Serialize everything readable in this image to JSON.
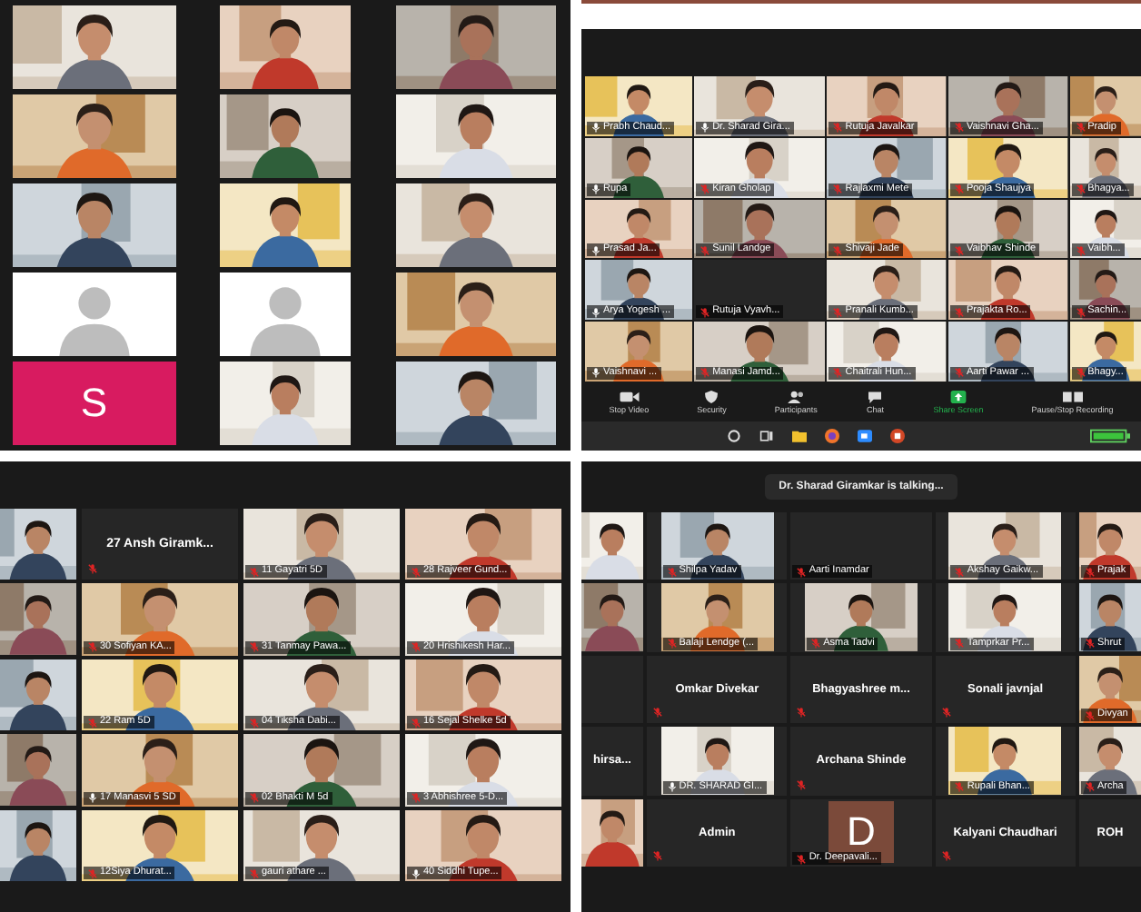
{
  "panels": [
    {
      "kind": "plain",
      "tiles": [
        {
          "kind": "video"
        },
        {
          "kind": "video"
        },
        {
          "kind": "video"
        },
        {
          "kind": "video"
        },
        {
          "kind": "video"
        },
        {
          "kind": "video"
        },
        {
          "kind": "video"
        },
        {
          "kind": "video"
        },
        {
          "kind": "video"
        },
        {
          "kind": "avatar"
        },
        {
          "kind": "avatar"
        },
        {
          "kind": "video"
        },
        {
          "kind": "letter",
          "letter": "S"
        },
        {
          "kind": "video"
        },
        {
          "kind": "video"
        }
      ]
    },
    {
      "kind": "zoom_window",
      "tiles": [
        {
          "kind": "video",
          "name": "Prabh Chaud...",
          "muted": false
        },
        {
          "kind": "video",
          "name": "Dr. Sharad Gira...",
          "muted": false
        },
        {
          "kind": "video",
          "name": "Rutuja Javalkar",
          "muted": true
        },
        {
          "kind": "video",
          "name": "Vaishnavi Gha...",
          "muted": true
        },
        {
          "kind": "video",
          "name": "Pradip",
          "muted": true
        },
        {
          "kind": "video",
          "name": "Rupa",
          "muted": false
        },
        {
          "kind": "video",
          "name": "Kiran Gholap",
          "muted": true
        },
        {
          "kind": "video",
          "name": "Rajlaxmi Mete",
          "muted": true
        },
        {
          "kind": "video",
          "name": "Pooja Shaujya",
          "muted": true
        },
        {
          "kind": "video",
          "name": "Bhagya...",
          "muted": true
        },
        {
          "kind": "video",
          "name": "Prasad Ja...",
          "muted": false
        },
        {
          "kind": "video",
          "name": "Sunil Landge",
          "muted": true
        },
        {
          "kind": "video",
          "name": "Shivaji Jade",
          "muted": true
        },
        {
          "kind": "video",
          "name": "Vaibhav Shinde",
          "muted": true
        },
        {
          "kind": "video",
          "name": "Vaibh...",
          "muted": true
        },
        {
          "kind": "video",
          "name": "Arya Yogesh ...",
          "muted": false
        },
        {
          "kind": "blank",
          "name": "Rutuja Vyavh...",
          "muted": true
        },
        {
          "kind": "video",
          "name": "Pranali Kumb...",
          "muted": true
        },
        {
          "kind": "video",
          "name": "Prajakta Ro...",
          "muted": true
        },
        {
          "kind": "video",
          "name": "Sachin...",
          "muted": true
        },
        {
          "kind": "video",
          "name": "Vaishnavi ...",
          "muted": false
        },
        {
          "kind": "video",
          "name": "Manasi Jamd...",
          "muted": true
        },
        {
          "kind": "video",
          "name": "Chaitrali Hun...",
          "muted": true
        },
        {
          "kind": "video",
          "name": "Aarti Pawar ...",
          "muted": true
        },
        {
          "kind": "video",
          "name": "Bhagy...",
          "muted": true
        }
      ],
      "toolbar": [
        {
          "label": "Stop Video"
        },
        {
          "label": "Security"
        },
        {
          "label": "Participants"
        },
        {
          "label": "Chat"
        },
        {
          "label": "Share Screen"
        },
        {
          "label": "Pause/Stop Recording"
        }
      ]
    },
    {
      "kind": "gallery",
      "tiles": [
        {
          "kind": "video"
        },
        {
          "kind": "name",
          "name": "27 Ansh Giramk...",
          "muted": true
        },
        {
          "kind": "video",
          "name": "11 Gayatri 5D",
          "muted": true
        },
        {
          "kind": "video",
          "name": "28 Rajveer Gund...",
          "muted": true
        },
        {
          "kind": "video"
        },
        {
          "kind": "video",
          "name": "30 Sofiyan KA...",
          "muted": true
        },
        {
          "kind": "video",
          "name": "31 Tanmay Pawa...",
          "muted": true
        },
        {
          "kind": "video",
          "name": "20 Hrishikesh Har...",
          "muted": true
        },
        {
          "kind": "video"
        },
        {
          "kind": "video",
          "name": "22 Ram 5D",
          "muted": true
        },
        {
          "kind": "video",
          "name": "04 Tiksha Dabi...",
          "muted": true
        },
        {
          "kind": "video",
          "name": "16 Sejal Shelke 5d",
          "muted": true
        },
        {
          "kind": "video"
        },
        {
          "kind": "video",
          "name": "17 Manasvi 5 SD",
          "muted": false
        },
        {
          "kind": "video",
          "name": "02 Bhakti M 5d",
          "muted": true
        },
        {
          "kind": "video",
          "name": "3 Abhishree 5-D...",
          "muted": true
        },
        {
          "kind": "video"
        },
        {
          "kind": "video",
          "name": "12Siya Dhurat...",
          "muted": true
        },
        {
          "kind": "video",
          "name": "gauri athare ...",
          "muted": true
        },
        {
          "kind": "video",
          "name": "40 Siddhi Tupe...",
          "muted": false
        }
      ]
    },
    {
      "kind": "talking",
      "banner": "Dr. Sharad Giramkar is talking...",
      "tiles": [
        {
          "kind": "video"
        },
        {
          "kind": "video",
          "name": "Shilpa Yadav",
          "muted": true
        },
        {
          "kind": "blank",
          "name": "Aarti Inamdar",
          "muted": true
        },
        {
          "kind": "video",
          "name": "Akshay Gaikw...",
          "muted": true
        },
        {
          "kind": "video",
          "name": "Prajak",
          "muted": true
        },
        {
          "kind": "video"
        },
        {
          "kind": "video",
          "name": "Balaji Lendge (...",
          "muted": true
        },
        {
          "kind": "video",
          "name": "Asma Tadvi",
          "muted": true
        },
        {
          "kind": "video",
          "name": "Tamprkar Pr...",
          "muted": true
        },
        {
          "kind": "video",
          "name": "Shrut",
          "muted": true
        },
        {
          "kind": "blank"
        },
        {
          "kind": "name",
          "name": "Omkar Divekar",
          "muted": true
        },
        {
          "kind": "name",
          "name": "Bhagyashree m...",
          "muted": true
        },
        {
          "kind": "name",
          "name": "Sonali javnjal",
          "muted": true
        },
        {
          "kind": "video",
          "name": "Divyan",
          "muted": true
        },
        {
          "kind": "name",
          "name": "hirsa..."
        },
        {
          "kind": "video",
          "name": "DR. SHARAD GI...",
          "muted": false
        },
        {
          "kind": "name",
          "name": "Archana Shinde",
          "muted": true
        },
        {
          "kind": "video",
          "name": "Rupali Bhan...",
          "muted": true
        },
        {
          "kind": "video",
          "name": "Archa",
          "muted": true
        },
        {
          "kind": "video"
        },
        {
          "kind": "name",
          "name": "Admin",
          "muted": true
        },
        {
          "kind": "letter",
          "letter": "D",
          "name": "Dr. Deepavali...",
          "muted": true
        },
        {
          "kind": "name",
          "name": "Kalyani Chaudhari",
          "muted": true
        },
        {
          "kind": "name",
          "name": "ROH"
        }
      ]
    }
  ]
}
